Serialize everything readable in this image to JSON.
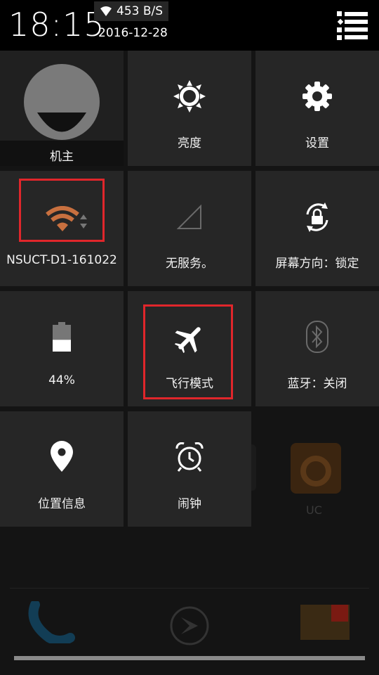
{
  "status": {
    "time": "18:15",
    "net_speed": "453 B/S",
    "date": "2016-12-28",
    "icons": [
      "wifi-icon",
      "menu-list-icon"
    ]
  },
  "tiles": {
    "owner": {
      "label": "机主",
      "icon": "avatar-icon"
    },
    "brightness": {
      "label": "亮度",
      "icon": "brightness-icon"
    },
    "settings": {
      "label": "设置",
      "icon": "gear-icon"
    },
    "wifi": {
      "label": "NSUCT-D1-161022",
      "icon": "wifi-icon",
      "color": "#c8703f"
    },
    "signal": {
      "label": "无服务。",
      "icon": "signal-icon"
    },
    "rotation": {
      "label": "屏幕方向：锁定",
      "icon": "rotation-lock-icon"
    },
    "battery": {
      "label": "44%",
      "icon": "battery-icon",
      "level": 0.44
    },
    "airplane": {
      "label": "飞行模式",
      "icon": "airplane-icon"
    },
    "bluetooth": {
      "label": "蓝牙：关闭",
      "icon": "bluetooth-icon"
    },
    "location": {
      "label": "位置信息",
      "icon": "location-pin-icon"
    },
    "alarm": {
      "label": "闹钟",
      "icon": "alarm-clock-icon"
    }
  },
  "background": {
    "app_label": "UC",
    "icons": [
      "uc-browser-icon",
      "phone-icon",
      "compass-icon",
      "app-badge-icon"
    ]
  },
  "colors": {
    "highlight": "#e0262b",
    "tile": "#262626",
    "wifi_accent": "#c8703f"
  }
}
